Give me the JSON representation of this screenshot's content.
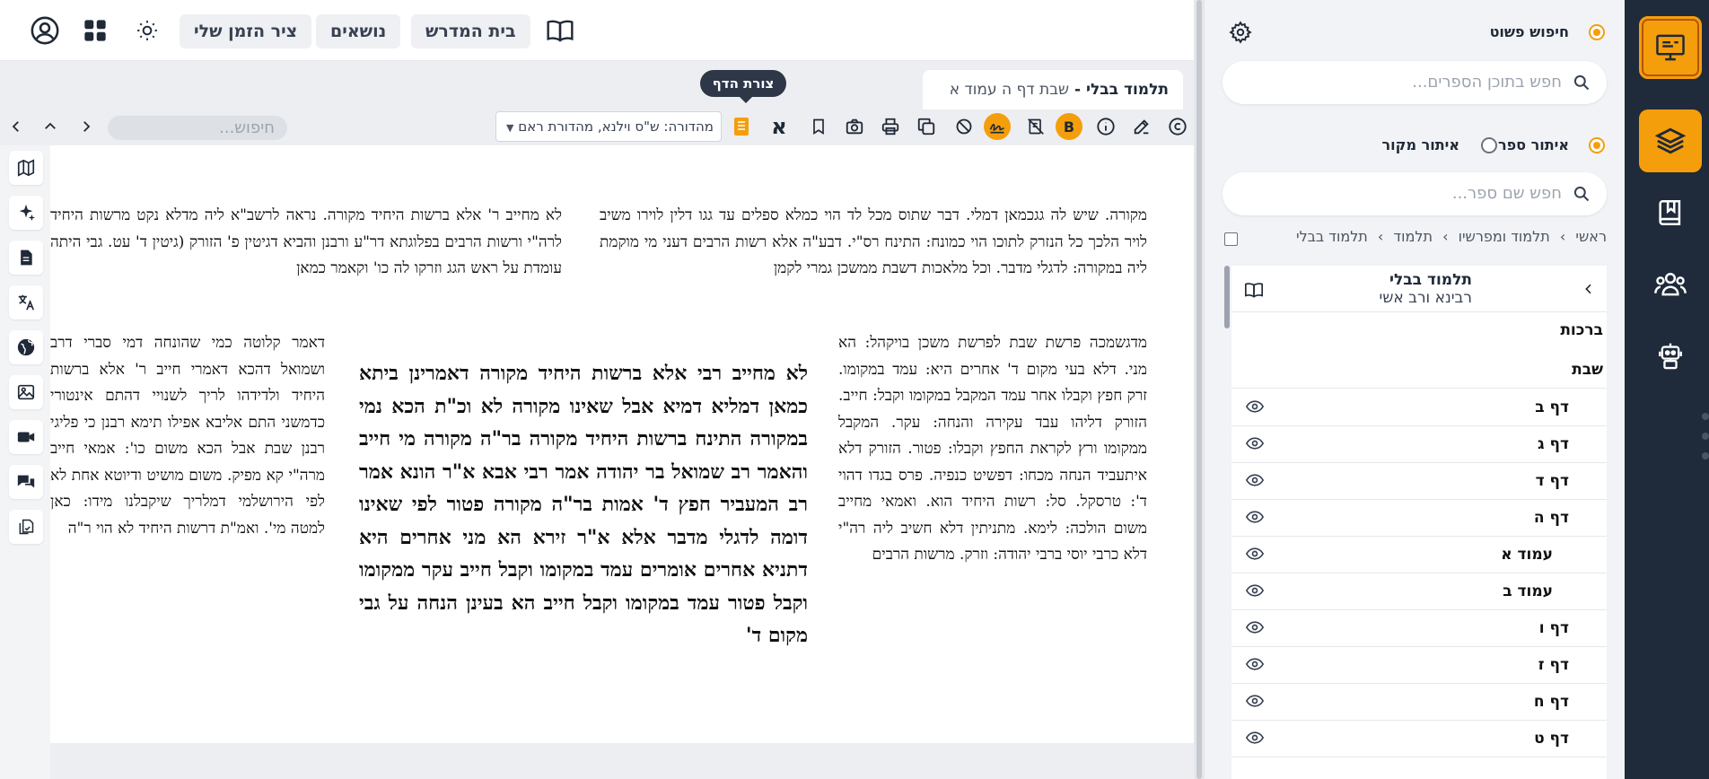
{
  "topbar": {
    "tabs": [
      {
        "label": "בית המדרש"
      },
      {
        "label": "נושאים"
      },
      {
        "label": "ציר הזמן שלי"
      }
    ]
  },
  "book_tab": {
    "title": "תלמוד בבלי",
    "separator": " - ",
    "location": "שבת דף ה עמוד א"
  },
  "tooltip": {
    "label": "צורת הדף"
  },
  "toolbar": {
    "search_placeholder": "חיפוש...",
    "edition_label": "מהדורה: ש\"ס וילנא, מהדורת ראם",
    "letter_button": "א",
    "bold_badge": "B"
  },
  "page": {
    "rashi_top": "מקורה. שיש לה גגכמאן דמלי. דבר שתוס מכל לד הוי כמלא ספלים עד גגו דלין לוירו משיב לויר הלכך כל הנזרק לתוכו הוי כמונח: התינח רס\"י. דבע\"ה אלא רשות הרבים דעני מי מוקמת ליה במקורה: לדגלי מדבר. וכל מלאכות דשבת ממשכן גמרי לקמן",
    "tosafot_top": "לא מחייב ר' אלא ברשות היחיד מקורה. נראה לרשב\"א ליה מדלא נקט מרשות היחיד לרה\"י ורשות הרבים בפלוגתא דר\"ע ורבנן והביא דגיטין פ' הזורק (גיטין ד' עט. גבי היתה עומדת על ראש הגג וזרקו לה כו' וקאמר כמאן",
    "main_text": "לא מחייב רבי אלא ברשות היחיד מקורה דאמרינן ביתא כמאן דמליא דמיא אבל שאינו מקורה לא וכ\"ת הכא נמי במקורה התינח ברשות היחיד מקורה בר\"ה מקורה מי חייב והאמר רב שמואל בר יהודה אמר רבי אבא א\"ר הונא אמר רב המעביר חפץ ד' אמות בר\"ה מקורה פטור לפי שאינו דומה לדגלי מדבר אלא א\"ר זירא הא מני אחרים היא דתניא אחרים אומרים עמד במקומו וקבל חייב עקר ממקומו וקבל פטור עמד במקומו וקבל חייב הא בעינן הנחה על גבי מקום ד'",
    "rashi_side": "מדגשמכה פרשת שבת לפרשת משכן בויקהל: הא מני. דלא בעי מקום ד' אחרים היא: עמד במקומו. זרק חפץ וקבלו אחר עמד המקבל במקומו וקבל: חייב. הזורק דליהו עבד עקירה והנחה: עקר. המקבל ממקומו ורץ לקראת החפץ וקבלו: פטור. הזורק דלא איתעביד הנחה מכחו: דפשיט כנפיה. פרס בגדו דהוי ד': טרסקל. סל: רשות היחיד הוא. ואמאי מחייב משום הולכה: לימא. מתניתין דלא חשיב ליה רה\"י דלא כרבי יוסי ברבי יהודה: וזרק. מרשות הרבים",
    "tosafot_side": "דאמר קלוטה כמי שהונחה דמי סברי דרב ושמואל דהכא דאמרי חייב ר' אלא ברשות היחיד ולדידהו לריך לשנויי דהתם אינטורי כדמשני התם אליבא אפילו תימא רבנן כי פליגי רבנן שבת אבל הכא משום כו': אמאי חייב מרה\"י קא מפיק. משום מושיט ודיוטא אחת לא לפי הירושלמי דמלריך שיקבלנו מידו: כאן למטה מי'. ואמ\"ת דרשות היחיד לא הוי ר\"ה"
  },
  "left_strip": {
    "icons": [
      "map-icon",
      "sparkle-icon",
      "document-icon",
      "translate-icon",
      "globe-icon",
      "image-icon",
      "video-icon",
      "chat-icon",
      "copy-document-icon"
    ]
  },
  "right_panel": {
    "simple_search_label": "חיפוש פשוט",
    "content_search_placeholder": "חפש בתוכן הספרים...",
    "book_filter_label": "איתור ספר",
    "source_filter_label": "איתור מקור",
    "book_name_placeholder": "חפש שם ספר...",
    "breadcrumbs": [
      "ראשי",
      "תלמוד ומפרשיו",
      "תלמוד",
      "תלמוד בבלי"
    ],
    "tree_header": {
      "title": "תלמוד בבלי",
      "subtitle": "רבינא ורב אשי"
    },
    "sections": [
      {
        "label": "ברכות"
      },
      {
        "label": "שבת"
      }
    ],
    "items": [
      {
        "label": "דף ב"
      },
      {
        "label": "דף ג"
      },
      {
        "label": "דף ד"
      },
      {
        "label": "דף ה"
      },
      {
        "label": "עמוד א"
      },
      {
        "label": "עמוד ב"
      },
      {
        "label": "דף ו"
      },
      {
        "label": "דף ז"
      },
      {
        "label": "דף ח"
      },
      {
        "label": "דף ט"
      }
    ]
  },
  "colors": {
    "accent": "#f59e0b",
    "nav_bg": "#1f2a3a",
    "tooltip_bg": "#2d3748"
  }
}
